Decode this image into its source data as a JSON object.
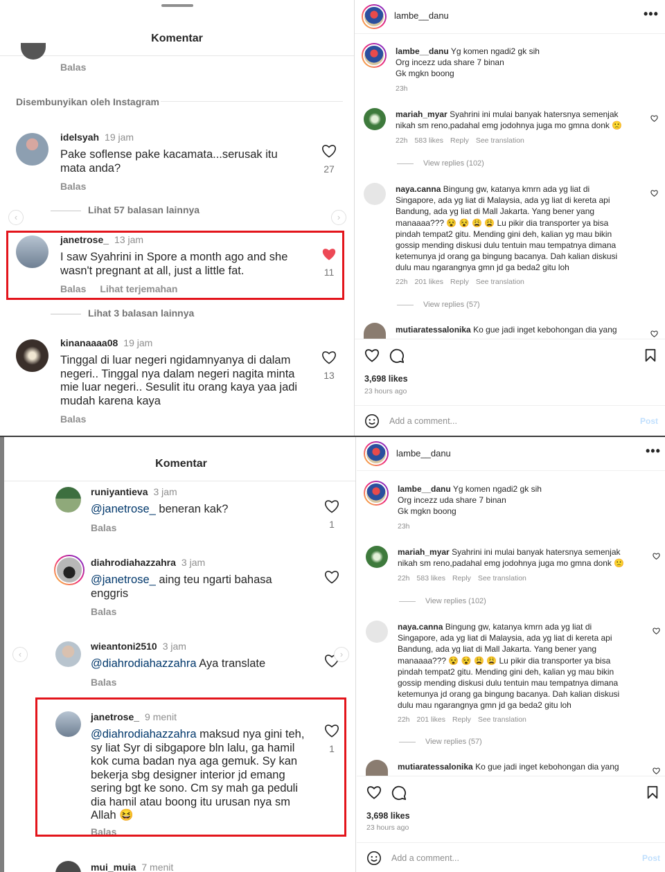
{
  "top_left": {
    "title": "Komentar",
    "top_reply": "Balas",
    "hidden_label": "Disembunyikan oleh Instagram",
    "comments": [
      {
        "user": "idelsyah",
        "time": "19 jam",
        "text": "Pake soflense pake kacamata...serusak itu mata anda?",
        "reply": "Balas",
        "likes": "27"
      },
      {
        "user": "janetrose_",
        "time": "13 jam",
        "text": "I saw Syahrini in Spore a month ago and she wasn't pregnant at all, just a little fat.",
        "reply": "Balas",
        "translate": "Lihat terjemahan",
        "likes": "11"
      },
      {
        "user": "kinanaaaa08",
        "time": "19 jam",
        "text": "Tinggal di luar negeri ngidamnyanya di dalam negeri.. Tinggal nya dalam negeri nagita minta mie luar negeri.. Sesulit itu orang kaya yaa jadi mudah karena kaya",
        "reply": "Balas",
        "likes": "13"
      }
    ],
    "more_replies_1": "Lihat 57 balasan lainnya",
    "more_replies_2": "Lihat 3 balasan lainnya"
  },
  "bottom_left": {
    "title": "Komentar",
    "comments": [
      {
        "user": "runiyantieva",
        "time": "3 jam",
        "mention": "@janetrose_",
        "text": " beneran kak?",
        "reply": "Balas",
        "likes": "1"
      },
      {
        "user": "diahrodiahazzahra",
        "time": "3 jam",
        "mention": "@janetrose_",
        "text": " aing teu ngarti bahasa enggris",
        "reply": "Balas",
        "likes": ""
      },
      {
        "user": "wieantoni2510",
        "time": "3 jam",
        "mention": "@diahrodiahazzahra",
        "text": " Aya translate",
        "reply": "Balas",
        "likes": ""
      },
      {
        "user": "janetrose_",
        "time": "9 menit",
        "mention": "@diahrodiahazzahra",
        "text": " maksud nya gini teh, sy liat Syr di sibgapore bln lalu, ga hamil kok cuma badan nya aga gemuk.  Sy kan bekerja sbg designer interior jd emang sering bgt ke sono. Cm sy mah ga peduli dia hamil atau boong itu urusan nya sm Allah 😆",
        "reply": "Balas",
        "likes": "1"
      },
      {
        "user": "mui_muia",
        "time": "7 menit"
      }
    ]
  },
  "post": {
    "account": "lambe__danu",
    "more": "•••",
    "caption_user": "lambe__danu",
    "caption_lines": [
      "Yg komen ngadi2 gk sih",
      "Org incezz uda share 7 binan",
      "Gk mgkn boong"
    ],
    "caption_time": "23h",
    "comments": [
      {
        "user": "mariah_myar",
        "lines": [
          "Syahrini ini mulai banyak hatersnya semenjak",
          "nikah sm reno,padahal emg jodohnya juga mo gmna donk 🙁"
        ],
        "time": "22h",
        "likes": "583 likes",
        "reply": "Reply",
        "translate": "See translation",
        "views": "View replies (102)"
      },
      {
        "user": "naya.canna",
        "lines": [
          "Bingung gw, katanya kmrn ada yg liat di",
          "Singapore, ada yg liat di Malaysia, ada yg liat di kereta api",
          "Bandung, ada yg liat di Mall Jakarta. Yang bener yang",
          "manaaaa??? 😵 😵 😩 😩  Lu pikir dia transporter ya bisa",
          "pindah tempat2 gitu. Mending gini deh, kalian yg mau bikin",
          "gossip mending diskusi dulu tentuin mau tempatnya dimana",
          "ketemunya jd orang ga bingung bacanya. Dah kalian diskusi",
          "dulu mau ngarangnya gmn jd ga beda2 gitu loh"
        ],
        "time": "22h",
        "likes": "201 likes",
        "reply": "Reply",
        "translate": "See translation",
        "views": "View replies (57)"
      },
      {
        "user": "mutiaratessalonika",
        "lines": [
          "Ko gue jadi inget kebohongan dia yang"
        ]
      }
    ],
    "likes": "3,698 likes",
    "ago": "23 hours ago",
    "add_comment": "Add a comment...",
    "post_btn": "Post"
  }
}
